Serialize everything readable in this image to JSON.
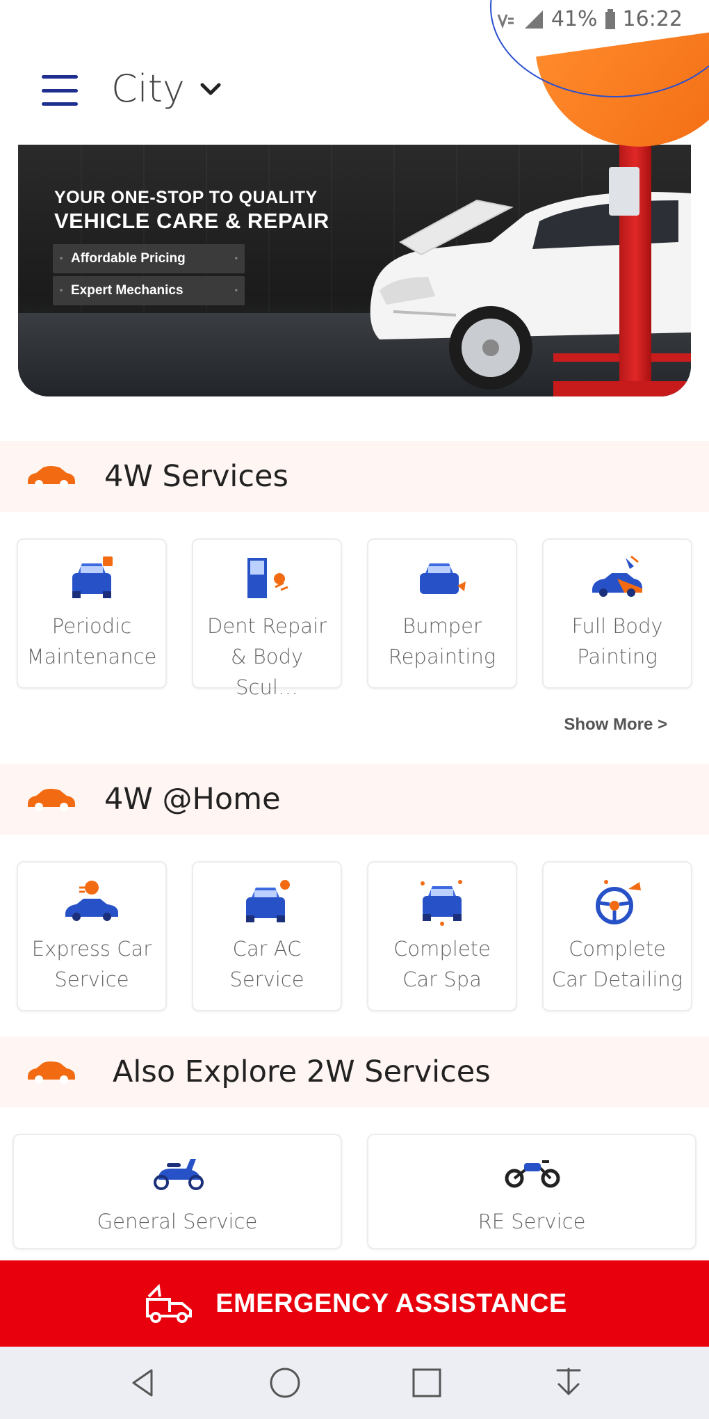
{
  "status_bar": {
    "battery": "41%",
    "time": "16:22"
  },
  "header": {
    "city_label": "City"
  },
  "banner": {
    "title_line1": "YOUR ONE-STOP TO QUALITY",
    "title_line2": "VEHICLE CARE & REPAIR",
    "chips": [
      "Affordable Pricing",
      "Expert Mechanics"
    ]
  },
  "sections": {
    "four_w": {
      "title": "4W Services",
      "items": [
        {
          "label": "Periodic\nMaintenance",
          "icon": "car-service-icon"
        },
        {
          "label": "Dent Repair\n& Body Scul…",
          "icon": "car-door-icon"
        },
        {
          "label": "Bumper\nRepainting",
          "icon": "bumper-paint-icon"
        },
        {
          "label": "Full Body\nPainting",
          "icon": "spray-paint-car-icon"
        }
      ],
      "show_more": "Show More >"
    },
    "four_w_home": {
      "title": "4W @Home",
      "items": [
        {
          "label": "Express Car\nService",
          "icon": "express-car-icon"
        },
        {
          "label": "Car AC\nService",
          "icon": "car-ac-icon"
        },
        {
          "label": "Complete\nCar Spa",
          "icon": "car-spa-icon"
        },
        {
          "label": "Complete\nCar Detailing",
          "icon": "steering-detailing-icon"
        }
      ]
    },
    "two_w": {
      "title": "Also Explore 2W Services",
      "items": [
        {
          "label": "General Service",
          "icon": "scooter-icon"
        },
        {
          "label": "RE Service",
          "icon": "motorcycle-icon"
        }
      ]
    }
  },
  "emergency": {
    "label": "EMERGENCY ASSISTANCE",
    "icon": "tow-truck-icon"
  },
  "colors": {
    "brand_blue": "#1f2f8f",
    "accent_orange": "#f26b12",
    "emergency_red": "#e8010c",
    "section_bg": "#fff5f2"
  }
}
